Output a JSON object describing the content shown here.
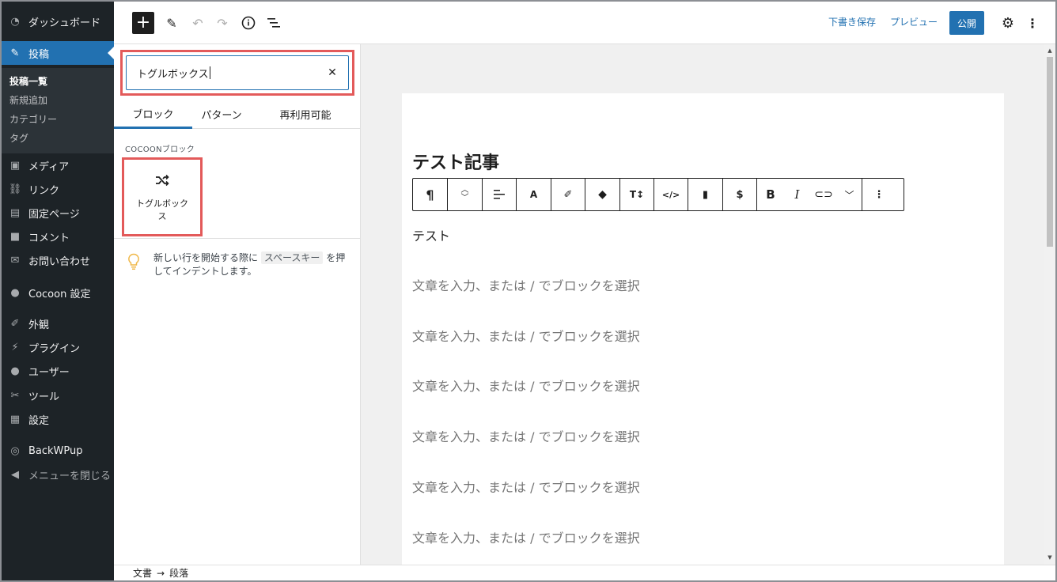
{
  "admin_menu": {
    "dashboard": "ダッシュボード",
    "posts": "投稿",
    "posts_sub": [
      "投稿一覧",
      "新規追加",
      "カテゴリー",
      "タグ"
    ],
    "media": "メディア",
    "links": "リンク",
    "pages": "固定ページ",
    "comments": "コメント",
    "contact": "お問い合わせ",
    "cocoon": "Cocoon 設定",
    "appearance": "外観",
    "plugins": "プラグイン",
    "users": "ユーザー",
    "tools": "ツール",
    "settings": "設定",
    "backwpup": "BackWPup",
    "collapse": "メニューを閉じる"
  },
  "toolbar": {
    "save_draft": "下書き保存",
    "preview": "プレビュー",
    "publish": "公開"
  },
  "inserter": {
    "search_value": "トグルボックス",
    "tabs": [
      "ブロック",
      "パターン",
      "再利用可能"
    ],
    "category_title": "COCOONブロック",
    "block_label": "トグルボックス",
    "tip_before": "新しい行を開始する際に",
    "tip_key": "スペースキー",
    "tip_after": "を押してインデントします。"
  },
  "editor": {
    "title": "テスト記事",
    "first_paragraph": "テスト",
    "placeholder": "文章を入力、または / でブロックを選択"
  },
  "footer": {
    "crumb_document": "文書",
    "arrow": "→",
    "crumb_paragraph": "段落"
  },
  "colors": {
    "admin_bg": "#1d2327",
    "accent": "#2271b1",
    "highlight_border": "#e35a5a"
  },
  "icons": {
    "add": "plus-icon",
    "edit": "pencil-icon",
    "undo": "undo-icon",
    "redo": "redo-icon",
    "info": "info-icon",
    "outline": "list-view-icon",
    "settings": "gear-icon",
    "more": "vertical-ellipsis-icon",
    "block": "shuffle-icon",
    "tip": "lightbulb-icon"
  }
}
